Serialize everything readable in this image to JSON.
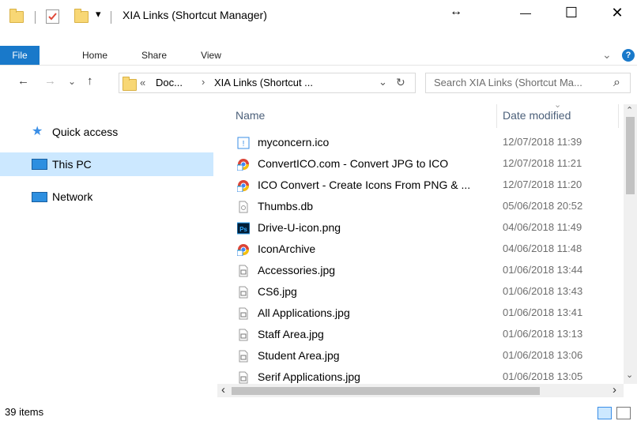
{
  "window": {
    "title": "XIA Links (Shortcut Manager)",
    "qat_dropdown_glyph": "▾",
    "resize_glyph": "↔",
    "minimize_glyph": "—",
    "maximize_glyph": "☐",
    "close_glyph": "✕"
  },
  "ribbon": {
    "tabs": [
      "File",
      "Home",
      "Share",
      "View"
    ],
    "collapse_glyph": "⌄",
    "help_glyph": "?"
  },
  "nav": {
    "back_glyph": "←",
    "forward_glyph": "→",
    "recent_glyph": "⌄",
    "up_glyph": "↑"
  },
  "address": {
    "overflow": "«",
    "crumbs": [
      "Doc...",
      "XIA Links (Shortcut ..."
    ],
    "crumb_sep": "›",
    "dropdown_glyph": "⌄",
    "refresh_glyph": "↻"
  },
  "search": {
    "placeholder": "Search XIA Links (Shortcut Ma...",
    "icon_glyph": "⌕"
  },
  "navpane": {
    "items": [
      "Quick access",
      "This PC",
      "Network"
    ]
  },
  "columns": {
    "name": "Name",
    "date": "Date modified",
    "sort_glyph": "⌄"
  },
  "files": [
    {
      "name": "myconcern.ico",
      "date": "12/07/2018 11:39",
      "icon": "ico-file-icon"
    },
    {
      "name": "ConvertICO.com - Convert JPG to ICO",
      "date": "12/07/2018 11:21",
      "icon": "chrome-shortcut-icon"
    },
    {
      "name": "ICO Convert - Create Icons From PNG & ...",
      "date": "12/07/2018 11:20",
      "icon": "chrome-shortcut-icon"
    },
    {
      "name": "Thumbs.db",
      "date": "05/06/2018 20:52",
      "icon": "db-file-icon"
    },
    {
      "name": "Drive-U-icon.png",
      "date": "04/06/2018 11:49",
      "icon": "photoshop-file-icon"
    },
    {
      "name": "IconArchive",
      "date": "04/06/2018 11:48",
      "icon": "chrome-shortcut-icon"
    },
    {
      "name": "Accessories.jpg",
      "date": "01/06/2018 13:44",
      "icon": "image-file-icon"
    },
    {
      "name": "CS6.jpg",
      "date": "01/06/2018 13:43",
      "icon": "image-file-icon"
    },
    {
      "name": "All Applications.jpg",
      "date": "01/06/2018 13:41",
      "icon": "image-file-icon"
    },
    {
      "name": "Staff Area.jpg",
      "date": "01/06/2018 13:13",
      "icon": "image-file-icon"
    },
    {
      "name": "Student Area.jpg",
      "date": "01/06/2018 13:06",
      "icon": "image-file-icon"
    },
    {
      "name": "Serif Applications.jpg",
      "date": "01/06/2018 13:05",
      "icon": "image-file-icon"
    }
  ],
  "scroll": {
    "up_glyph": "⌃",
    "down_glyph": "⌄",
    "left_glyph": "‹",
    "right_glyph": "›"
  },
  "status": {
    "count": "39 items"
  },
  "colors": {
    "accent": "#1979ca",
    "selection": "#cce8ff",
    "folder": "#f8d775"
  }
}
